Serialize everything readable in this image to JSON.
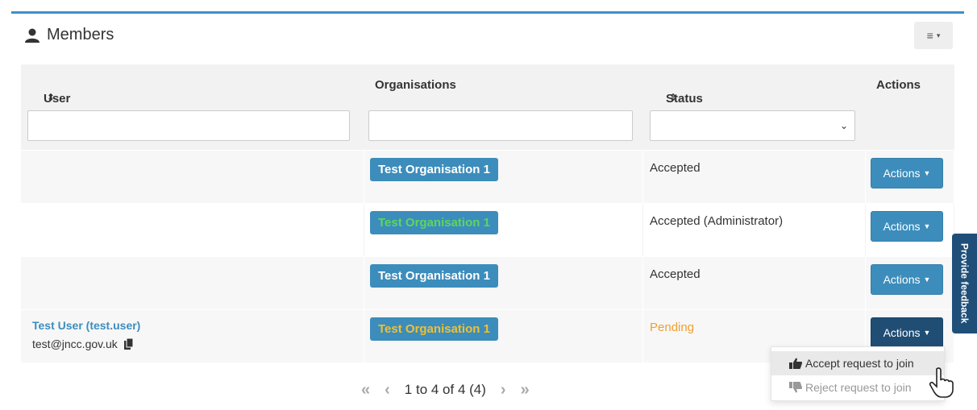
{
  "panel": {
    "title": "Members",
    "title_icon": "user-icon",
    "menu_icon": "≡",
    "menu_caret": "▾"
  },
  "table": {
    "headers": [
      {
        "label": "User",
        "sortable": true
      },
      {
        "label": "Organisations",
        "sortable": false
      },
      {
        "label": "Status",
        "sortable": true
      },
      {
        "label": "Actions",
        "sortable": false
      }
    ],
    "sort_glyph": "⇕",
    "filters": {
      "user": "",
      "organisations": "",
      "status_selected": "",
      "select_chevron": "⌄"
    },
    "rows": [
      {
        "user_name": "",
        "user_email": "",
        "organisation": "Test Organisation 1",
        "status": "Accepted",
        "actions_label": "Actions"
      },
      {
        "user_name": "",
        "user_email": "",
        "organisation": "Test Organisation 1",
        "status": "Accepted (Administrator)",
        "actions_label": "Actions"
      },
      {
        "user_name": "",
        "user_email": "",
        "organisation": "Test Organisation 1",
        "status": "Accepted",
        "actions_label": "Actions"
      },
      {
        "user_name": "Test User (test.user)",
        "user_email": "test@jncc.gov.uk",
        "organisation": "Test Organisation 1",
        "status": "Pending",
        "actions_label": "Actions"
      }
    ]
  },
  "pagination": {
    "first": "«",
    "prev": "‹",
    "summary": "1 to 4 of 4 (4)",
    "next": "›",
    "last": "»"
  },
  "actions_dropdown": {
    "items": [
      {
        "label": "Accept request to join",
        "icon": "thumbs-up-icon"
      },
      {
        "label": "Reject request to join",
        "icon": "thumbs-down-icon"
      }
    ]
  },
  "feedback_tab": {
    "label": "Provide feedback"
  },
  "colors": {
    "primary": "#3c8dbc",
    "primary_active": "#204d74",
    "org_text_default": "#ffffff",
    "org_text_admin": "#5cd65c",
    "org_text_pending": "#f0c030",
    "status_pending": "#f0a030",
    "feedback": "#1f4f79"
  }
}
